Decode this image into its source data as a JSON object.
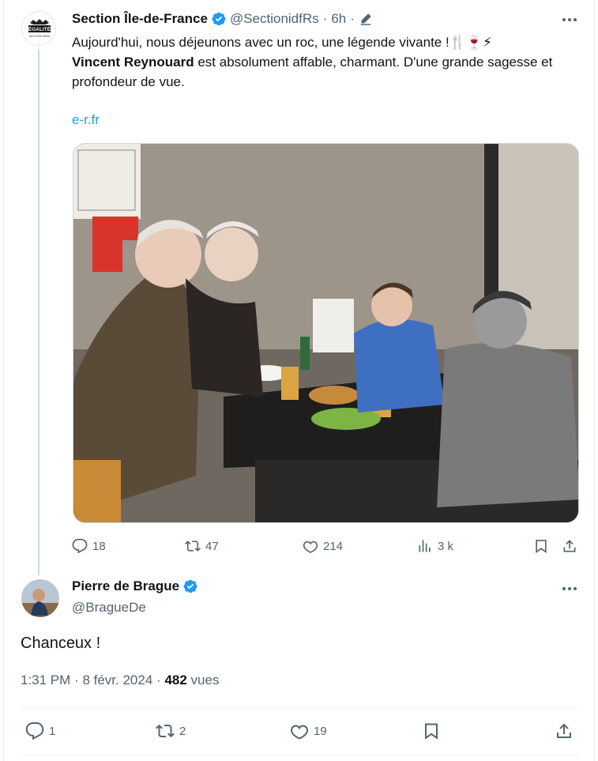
{
  "tweet": {
    "author_name": "Section Île-de-France",
    "handle": "@SectionidfRs",
    "time": "6h",
    "separator": "·",
    "line1": "Aujourd'hui, nous déjeunons avec un roc, une légende vivante !🍴🍷⚡",
    "line2_bold": "Vincent Reynouard",
    "line2_rest": " est absolument affable, charmant. D'une grande sagesse et profondeur de vue.",
    "link": "e-r.fr",
    "avatar_text": "ÉGALITÉ",
    "avatar_subtext": "SECTION PARIS",
    "replies": "18",
    "reposts": "47",
    "likes": "214",
    "views": "3 k"
  },
  "reply": {
    "author_name": "Pierre de Brague",
    "handle": "@BragueDe",
    "text": "Chanceux !",
    "time": "1:31 PM",
    "date": "8 févr. 2024",
    "views_count": "482",
    "views_label": "vues",
    "replies": "1",
    "reposts": "2",
    "likes": "19"
  },
  "colors": {
    "accent": "#1d9bf0",
    "text": "#0f1419",
    "muted": "#536471"
  },
  "icons": [
    "verified-badge-icon",
    "edit-pencil-icon",
    "more-icon",
    "reply-icon",
    "repost-icon",
    "like-icon",
    "views-icon",
    "bookmark-icon",
    "share-icon"
  ]
}
